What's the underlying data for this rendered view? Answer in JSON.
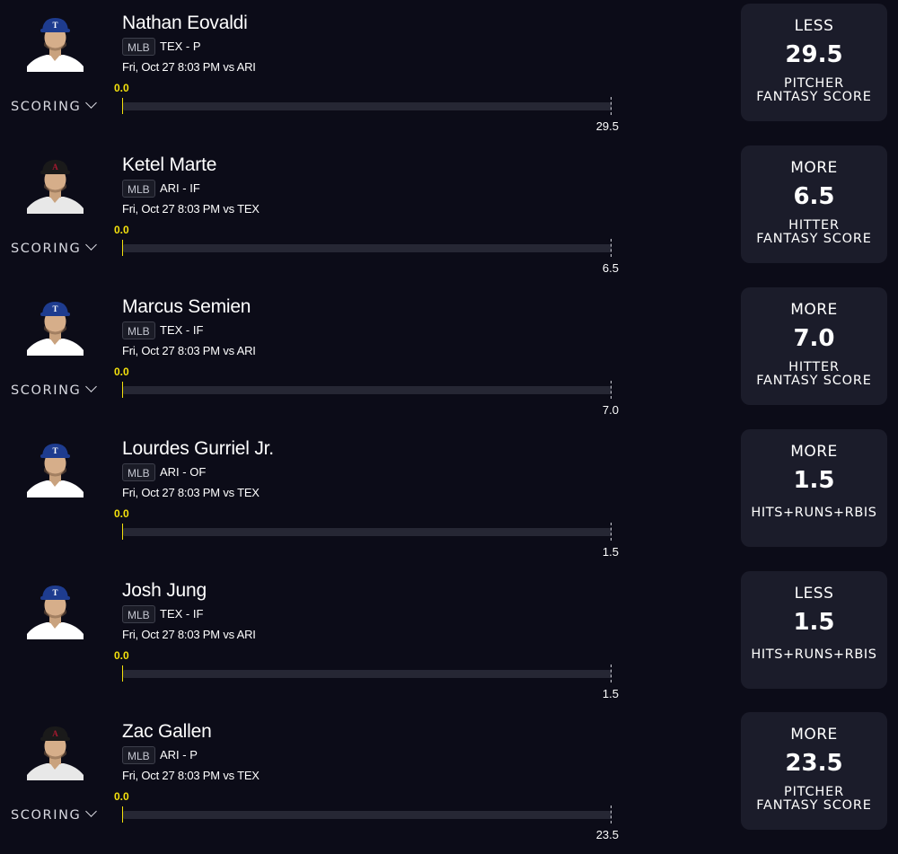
{
  "picks": [
    {
      "player": "Nathan Eovaldi",
      "league": "MLB",
      "team_pos": "TEX - P",
      "game": "Fri, Oct 27 8:03 PM  vs ARI",
      "current": "0.0",
      "line": "29.5",
      "scoring_label": "SCORING",
      "show_scoring": true,
      "direction": "LESS",
      "stat_line1": "PITCHER",
      "stat_line2": "FANTASY SCORE",
      "cap": "#1e3c8f",
      "jersey": "#ffffff",
      "logo": "T",
      "icon": "player-headshot"
    },
    {
      "player": "Ketel Marte",
      "league": "MLB",
      "team_pos": "ARI - IF",
      "game": "Fri, Oct 27 8:03 PM  vs TEX",
      "current": "0.0",
      "line": "6.5",
      "scoring_label": "SCORING",
      "show_scoring": true,
      "direction": "MORE",
      "stat_line1": "HITTER",
      "stat_line2": "FANTASY SCORE",
      "cap": "#1a1a1a",
      "jersey": "#e8e8e8",
      "logo": "A",
      "icon": "player-headshot"
    },
    {
      "player": "Marcus Semien",
      "league": "MLB",
      "team_pos": "TEX - IF",
      "game": "Fri, Oct 27 8:03 PM  vs ARI",
      "current": "0.0",
      "line": "7.0",
      "scoring_label": "SCORING",
      "show_scoring": true,
      "direction": "MORE",
      "stat_line1": "HITTER",
      "stat_line2": "FANTASY SCORE",
      "cap": "#1e3c8f",
      "jersey": "#ffffff",
      "logo": "T",
      "icon": "player-headshot"
    },
    {
      "player": "Lourdes Gurriel Jr.",
      "league": "MLB",
      "team_pos": "ARI - OF",
      "game": "Fri, Oct 27 8:03 PM  vs TEX",
      "current": "0.0",
      "line": "1.5",
      "scoring_label": "",
      "show_scoring": false,
      "direction": "MORE",
      "stat_line1": "HITS+RUNS+RBIS",
      "stat_line2": "",
      "cap": "#1e3c8f",
      "jersey": "#ffffff",
      "logo": "T",
      "icon": "player-headshot"
    },
    {
      "player": "Josh Jung",
      "league": "MLB",
      "team_pos": "TEX - IF",
      "game": "Fri, Oct 27 8:03 PM  vs ARI",
      "current": "0.0",
      "line": "1.5",
      "scoring_label": "",
      "show_scoring": false,
      "direction": "LESS",
      "stat_line1": "HITS+RUNS+RBIS",
      "stat_line2": "",
      "cap": "#1e3c8f",
      "jersey": "#ffffff",
      "logo": "T",
      "icon": "player-headshot"
    },
    {
      "player": "Zac Gallen",
      "league": "MLB",
      "team_pos": "ARI - P",
      "game": "Fri, Oct 27 8:03 PM  vs TEX",
      "current": "0.0",
      "line": "23.5",
      "scoring_label": "SCORING",
      "show_scoring": true,
      "direction": "MORE",
      "stat_line1": "PITCHER",
      "stat_line2": "FANTASY SCORE",
      "cap": "#1a1a1a",
      "jersey": "#e8e8e8",
      "logo": "A",
      "icon": "player-headshot"
    }
  ],
  "colors": {
    "background": "#0c0c18",
    "card": "#1b1c2a",
    "progress_start": "#f5e20c",
    "track": "#262734"
  }
}
